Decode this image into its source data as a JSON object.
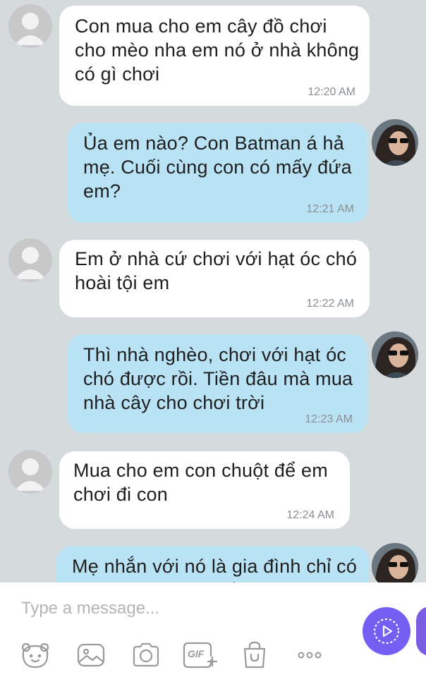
{
  "messages": [
    {
      "text": "Con mua cho em cây đồ chơi\ncho mèo nha em nó ở nhà không\ncó gì chơi",
      "time": "12:20 AM",
      "from": "other"
    },
    {
      "text": "Ủa em nào? Con Batman á hả\nmẹ. Cuối cùng con có mấy đứa\nem?",
      "time": "12:21 AM",
      "from": "me"
    },
    {
      "text": "Em ở nhà cứ chơi với hạt óc chó\nhoài tội em",
      "time": "12:22 AM",
      "from": "other"
    },
    {
      "text": "Thì nhà nghèo, chơi với hạt óc\nchó được rồi. Tiền đâu mà mua\nnhà cây cho chơi trời",
      "time": "12:23 AM",
      "from": "me"
    },
    {
      "text": "Mua cho em con chuột để em\nchơi đi con",
      "time": "12:24 AM",
      "from": "other"
    },
    {
      "text": "Mẹ nhắn với nó là gia đình chỉ có\nó chó thôi nhà thì rồi thì nhà thì",
      "time": "",
      "from": "me"
    }
  ],
  "composer": {
    "placeholder": "Type a message...",
    "toolbar": [
      "sticker-icon",
      "gallery-icon",
      "camera-icon",
      "gif-icon",
      "shopping-bag-icon",
      "more-icon"
    ],
    "gif_label": "GIF"
  },
  "colors": {
    "chat_background": "#d5dadd",
    "incoming_bubble": "#ffffff",
    "outgoing_bubble": "#b9e3f5",
    "accent": "#7360f2",
    "toolbar_icon": "#9a9a9a"
  }
}
